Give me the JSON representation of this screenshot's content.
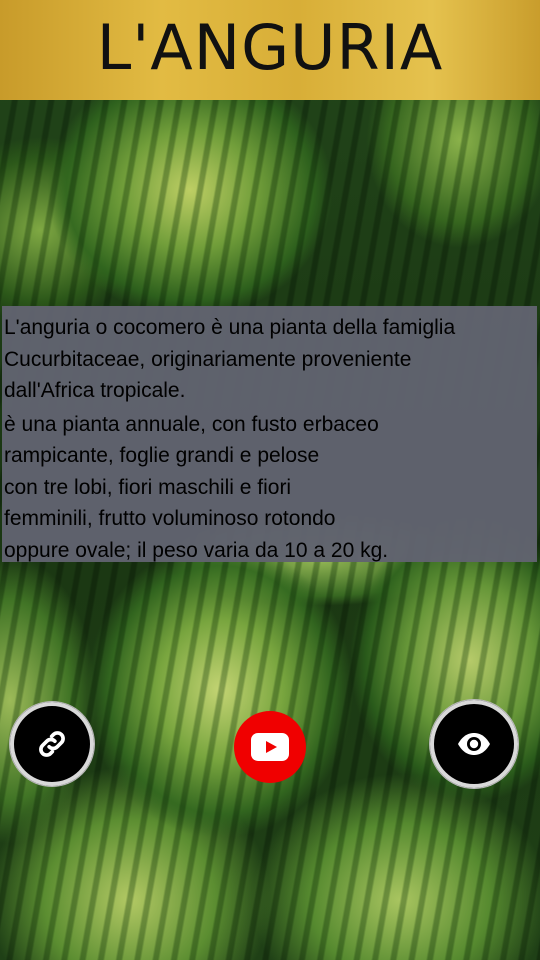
{
  "header": {
    "title": "L'ANGURIA"
  },
  "description": {
    "paragraphs": [
      "L'anguria o cocomero è una pianta della famiglia\n Cucurbitaceae, originariamente proveniente\ndall'Africa tropicale.",
      "è una pianta annuale, con fusto erbaceo\n rampicante, foglie grandi e pelose\ncon tre lobi, fiori maschili e fiori\nfemminili, frutto voluminoso rotondo\noppure ovale; il peso varia da 10 a 20 kg."
    ]
  },
  "background": {
    "image": "watermelons"
  },
  "actions": {
    "link_icon": "link-icon",
    "youtube_icon": "youtube-play-icon",
    "eye_icon": "eye-icon"
  },
  "colors": {
    "header_gold": "#d8ae37",
    "panel_gray": "#61636f",
    "youtube_red": "#f00000",
    "button_black": "#000000"
  }
}
